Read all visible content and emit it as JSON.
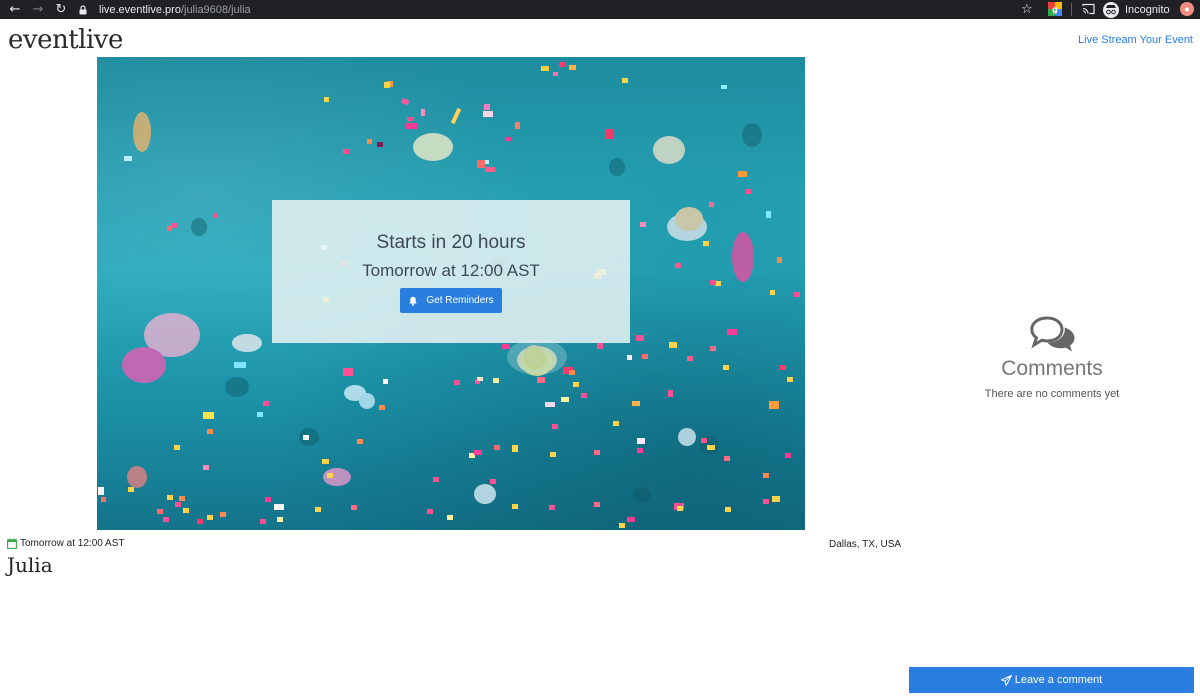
{
  "browser": {
    "url_host": "live.eventlive.pro",
    "url_path": "/julia9608/julia",
    "profile_label": "Incognito"
  },
  "site": {
    "logo": "eventlive",
    "top_link": "Live Stream Your Event"
  },
  "countdown": {
    "title": "Starts in 20 hours",
    "subtitle": "Tomorrow at 12:00 AST",
    "button_label": "Get Reminders"
  },
  "event": {
    "date": "Tomorrow at 12:00 AST",
    "location": "Dallas, TX, USA",
    "name": "Julia"
  },
  "comments": {
    "title": "Comments",
    "empty_text": "There are no comments yet",
    "button_label": "Leave a comment"
  },
  "colors": {
    "accent": "#2a7ee0",
    "hero_teal": "#27a9bc",
    "chrome_bg": "#202124"
  }
}
